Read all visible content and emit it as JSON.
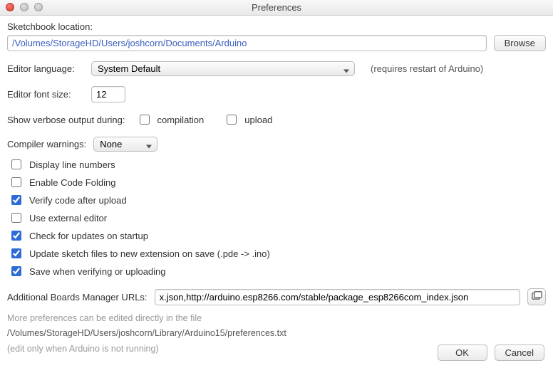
{
  "window": {
    "title": "Preferences"
  },
  "sketchbook": {
    "label": "Sketchbook location:",
    "path": "/Volumes/StorageHD/Users/joshcorn/Documents/Arduino",
    "browse": "Browse"
  },
  "editor_language": {
    "label": "Editor language:",
    "value": "System Default",
    "hint": "(requires restart of Arduino)"
  },
  "editor_font_size": {
    "label": "Editor font size:",
    "value": "12"
  },
  "verbose": {
    "label": "Show verbose output during:",
    "compilation_label": "compilation",
    "compilation_checked": false,
    "upload_label": "upload",
    "upload_checked": false
  },
  "compiler_warnings": {
    "label": "Compiler warnings:",
    "value": "None"
  },
  "checks": [
    {
      "label": "Display line numbers",
      "checked": false
    },
    {
      "label": "Enable Code Folding",
      "checked": false
    },
    {
      "label": "Verify code after upload",
      "checked": true
    },
    {
      "label": "Use external editor",
      "checked": false
    },
    {
      "label": "Check for updates on startup",
      "checked": true
    },
    {
      "label": "Update sketch files to new extension on save (.pde -> .ino)",
      "checked": true
    },
    {
      "label": "Save when verifying or uploading",
      "checked": true
    }
  ],
  "boards_urls": {
    "label": "Additional Boards Manager URLs:",
    "value": "x.json,http://arduino.esp8266.com/stable/package_esp8266com_index.json"
  },
  "footnote": {
    "line1": "More preferences can be edited directly in the file",
    "path": "/Volumes/StorageHD/Users/joshcorn/Library/Arduino15/preferences.txt",
    "line2": "(edit only when Arduino is not running)"
  },
  "buttons": {
    "ok": "OK",
    "cancel": "Cancel"
  }
}
